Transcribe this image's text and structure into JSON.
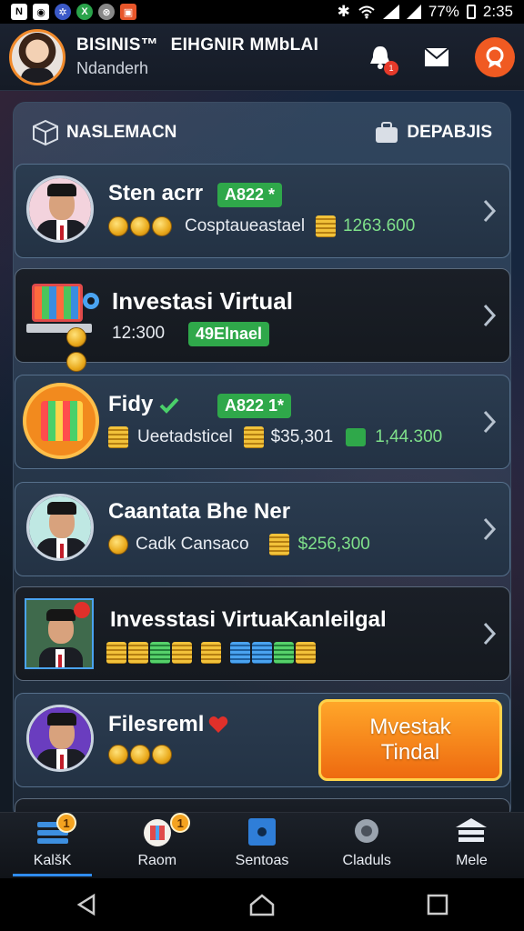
{
  "status_bar": {
    "battery": "77%",
    "time": "2:35"
  },
  "header": {
    "title_a": "BISINIS™",
    "title_b": "EIHGNIR MMbLAI",
    "subtitle": "Ndanderh",
    "notification_badge": "1"
  },
  "panel": {
    "left_label": "NASLEMACN",
    "right_label": "DEPABJIS"
  },
  "cards": [
    {
      "name": "Sten acrr",
      "tag": "A822 *",
      "sub": "Cosptaueastael",
      "value": "1263.600"
    },
    {
      "name": "Investasi Virtual",
      "number": "12:300",
      "tag": "49Elnael"
    },
    {
      "name": "Fidy",
      "tag": "A822 1*",
      "sub": "Ueetadsticel",
      "amount": "$35,301",
      "value": "1,44.300"
    },
    {
      "name": "Caantata Bhe Ner",
      "sub": "Cadk Cansaco",
      "value": "$256,300"
    },
    {
      "name": "Invesstasi VirtuaKanleilgal"
    },
    {
      "name": "Filesreml",
      "cta_line1": "Mvestak",
      "cta_line2": "Tindal"
    }
  ],
  "bottom_nav": {
    "items": [
      {
        "label": "KalšK",
        "badge": "1",
        "icon": "list-icon"
      },
      {
        "label": "Raom",
        "badge": "1",
        "icon": "gift-icon"
      },
      {
        "label": "Sentoas",
        "icon": "safe-icon"
      },
      {
        "label": "Claduls",
        "icon": "gear-icon"
      },
      {
        "label": "Mele",
        "icon": "bank-icon"
      }
    ]
  },
  "colors": {
    "accent": "#f05a22",
    "tag_green": "#2fa84a",
    "value_green": "#7fe08a",
    "cta_orange": "#ee6a10"
  }
}
